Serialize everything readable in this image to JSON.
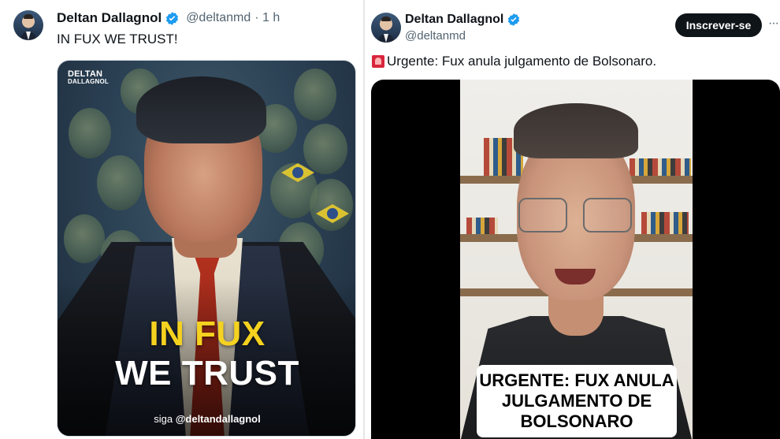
{
  "left_tweet": {
    "author_name": "Deltan Dallagnol",
    "author_handle": "@deltanmd",
    "timestamp": "· 1 h",
    "text": "IN FUX WE TRUST!",
    "image": {
      "logo_line1": "DELTAN",
      "logo_line2": "DALLAGNOL",
      "headline_line1": "IN FUX",
      "headline_line2": "WE TRUST",
      "signature_prefix": "siga",
      "signature_handle": "@deltandallagnol"
    }
  },
  "right_tweet": {
    "author_name": "Deltan Dallagnol",
    "author_handle": "@deltanmd",
    "subscribe_label": "Inscrever-se",
    "more_label": "···",
    "alert_icon": "police-siren-icon",
    "text": "Urgente: Fux anula julgamento de Bolsonaro.",
    "video": {
      "caption_lines": [
        "URGENTE: FUX ANULA",
        "JULGAMENTO DE",
        "BOLSONARO"
      ]
    }
  },
  "colors": {
    "verified_badge": "#1d9bf0",
    "headline_yellow": "#f5d21f",
    "subscribe_bg": "#0f1419",
    "handle_gray": "#536471"
  }
}
